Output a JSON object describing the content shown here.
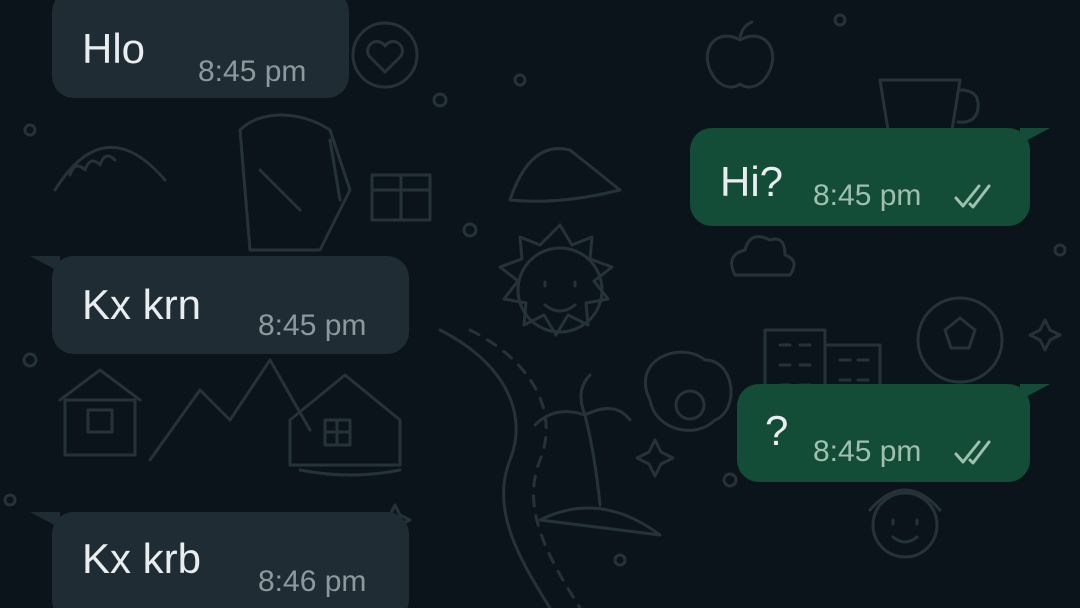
{
  "chat": {
    "messages": [
      {
        "direction": "incoming",
        "text": "Hlo",
        "time": "8:45 pm"
      },
      {
        "direction": "outgoing",
        "text": "Hi?",
        "time": "8:45 pm",
        "status": "double-check-icon"
      },
      {
        "direction": "incoming",
        "text": "Kx krn",
        "time": "8:45 pm"
      },
      {
        "direction": "outgoing",
        "text": "?",
        "time": "8:45 pm",
        "status": "double-check-icon"
      },
      {
        "direction": "incoming",
        "text": "Kx krb",
        "time": "8:46 pm"
      }
    ]
  },
  "colors": {
    "background": "#0b141a",
    "incoming_bubble": "#1f2c34",
    "outgoing_bubble": "#134d37",
    "text": "#e9edef",
    "timestamp": "#8c9a9f"
  }
}
